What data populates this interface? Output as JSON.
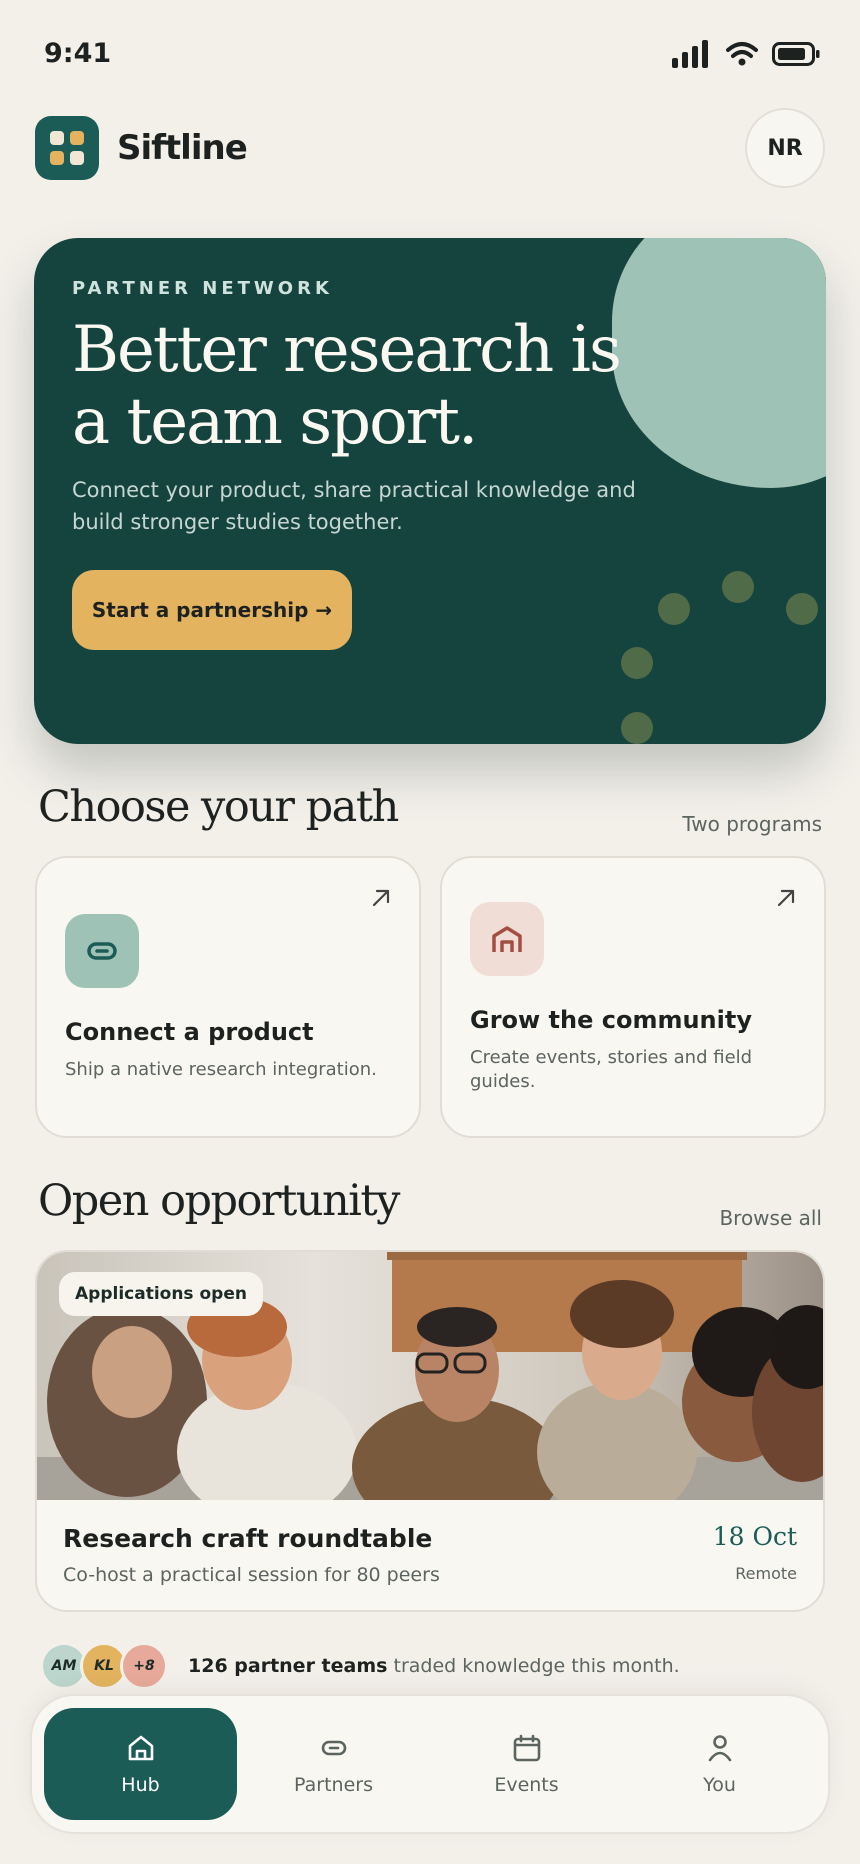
{
  "status_bar": {
    "time": "9:41"
  },
  "app": {
    "name": "Siftline",
    "user_initials": "NR"
  },
  "hero": {
    "eyebrow": "PARTNER NETWORK",
    "headline": "Better research is a team sport.",
    "subtext": "Connect your product, share practical knowledge and build stronger studies together.",
    "cta_label": "Start a partnership →"
  },
  "paths": {
    "title": "Choose your path",
    "aside": "Two programs",
    "cards": [
      {
        "title": "Connect a product",
        "description": "Ship a native research integration.",
        "icon": "link-icon"
      },
      {
        "title": "Grow the community",
        "description": "Create events, stories and field guides.",
        "icon": "community-icon"
      }
    ]
  },
  "opportunity": {
    "title": "Open opportunity",
    "aside": "Browse all",
    "badge": "Applications open",
    "event_title": "Research craft roundtable",
    "event_description": "Co-host a practical session for 80 peers",
    "date": "18 Oct",
    "location": "Remote"
  },
  "stats": {
    "avatars": [
      "AM",
      "KL",
      "+8"
    ],
    "highlight": "126 partner teams",
    "text": " traded knowledge this month."
  },
  "tabs": [
    {
      "label": "Hub",
      "icon": "home-icon",
      "active": true
    },
    {
      "label": "Partners",
      "icon": "link-icon",
      "active": false
    },
    {
      "label": "Events",
      "icon": "calendar-icon",
      "active": false
    },
    {
      "label": "You",
      "icon": "user-icon",
      "active": false
    }
  ],
  "colors": {
    "background": "#f3f0ea",
    "primary": "#1b5d56",
    "hero": "#15443f",
    "accent": "#e3b35f",
    "mint": "#9fc2b6",
    "blush": "#f0ddd6"
  }
}
